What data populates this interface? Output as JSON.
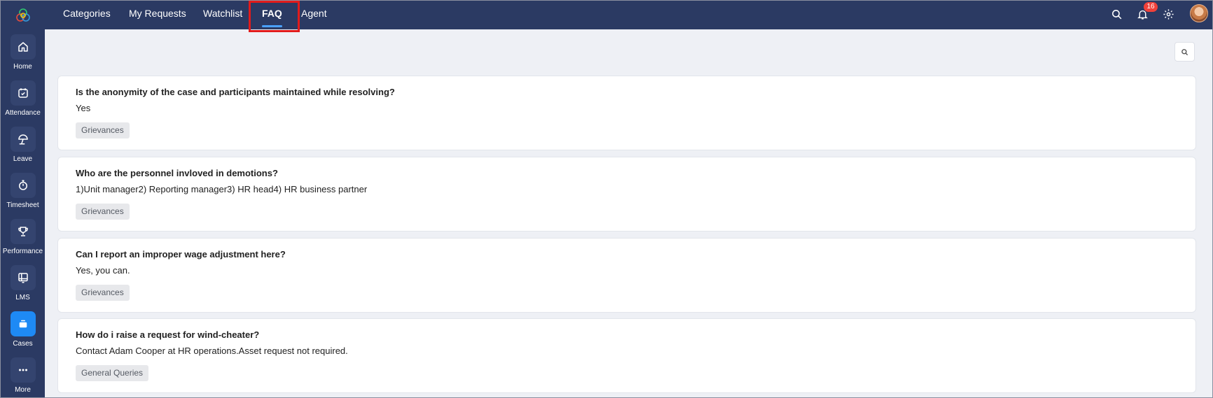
{
  "sidebar": {
    "logo_icon": "zoho-people-logo-icon",
    "items": [
      {
        "label": "Home",
        "icon": "home-icon"
      },
      {
        "label": "Attendance",
        "icon": "calendar-check-icon"
      },
      {
        "label": "Leave",
        "icon": "beach-umbrella-icon"
      },
      {
        "label": "Timesheet",
        "icon": "stopwatch-icon"
      },
      {
        "label": "Performance",
        "icon": "trophy-icon"
      },
      {
        "label": "LMS",
        "icon": "lms-board-icon"
      },
      {
        "label": "Cases",
        "icon": "cases-tray-icon",
        "active": true
      },
      {
        "label": "More",
        "icon": "more-dots-icon"
      }
    ]
  },
  "topbar": {
    "tabs": [
      {
        "label": "Categories"
      },
      {
        "label": "My Requests"
      },
      {
        "label": "Watchlist"
      },
      {
        "label": "FAQ",
        "active": true
      },
      {
        "label": "Agent"
      }
    ],
    "notification_count": "16",
    "icons": [
      "search-icon",
      "bell-icon",
      "gear-icon",
      "avatar"
    ]
  },
  "faqs": [
    {
      "question": "Is the anonymity of the case and participants maintained while resolving?",
      "answer": "Yes",
      "category": "Grievances"
    },
    {
      "question": "Who are the personnel invloved in demotions?",
      "answer": "1)Unit manager2) Reporting manager3) HR head4) HR business partner",
      "category": "Grievances"
    },
    {
      "question": "Can I report an improper wage adjustment here?",
      "answer": "Yes, you can.",
      "category": "Grievances"
    },
    {
      "question": "How do i raise a request for wind-cheater?",
      "answer": "Contact Adam Cooper at HR operations.Asset request not required.",
      "category": "General Queries"
    }
  ],
  "colors": {
    "nav_bg": "#2b3a63",
    "active_nav": "#1e8af5",
    "highlight": "#e21b1b",
    "badge": "#f0413a",
    "page_bg": "#eef0f5"
  }
}
